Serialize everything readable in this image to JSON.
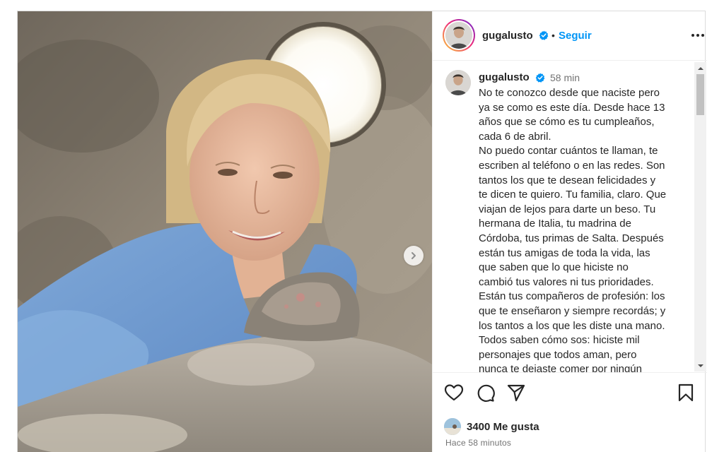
{
  "post": {
    "username": "gugalusto",
    "follow_label": "Seguir",
    "dot": "•",
    "time_short": "58 min",
    "caption": "No te conozco desde que naciste pero\nya se como es este día. Desde hace 13\naños que se cómo es tu cumpleaños,\ncada 6 de abril.\nNo puedo contar cuántos te llaman, te\nescriben al teléfono o en las redes. Son\ntantos los que te desean felicidades y\nte dicen te quiero. Tu familia, claro. Que\nviajan de lejos para darte un beso. Tu\nhermana de Italia, tu madrina de\nCórdoba, tus primas de Salta. Después\nestán tus amigas de toda la vida, las\nque saben que lo que hiciste no\ncambió tus valores ni tus prioridades.\nEstán tus compañeros de profesión: los\nque te enseñaron y siempre recordás; y\nlos tantos a los que les diste una mano.\nTodos saben cómo sos: hiciste mil\npersonajes que todos aman, pero\nnunca te dejaste comer por ningún",
    "likes": "3400 Me gusta",
    "time_ago": "Hace 58 minutos"
  },
  "icons": {
    "verified": "verified-badge-icon",
    "more": "more-options-icon",
    "like": "heart-icon",
    "comment": "comment-icon",
    "share": "paper-plane-icon",
    "save": "bookmark-icon",
    "next": "chevron-right-icon"
  },
  "colors": {
    "accent": "#0095f6",
    "verified": "#0095f6",
    "muted": "#737373",
    "text": "#262626"
  }
}
